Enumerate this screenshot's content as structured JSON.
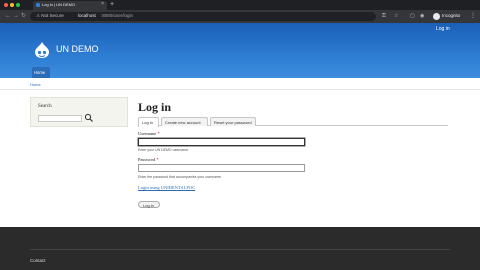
{
  "browser": {
    "tab_title": "Log in | UN DEMO",
    "tab_close": "×",
    "new_tab": "+",
    "security_label": "Not Secure",
    "url_host": "localhost",
    "url_path": ":8080/user/login",
    "profile_label": "Incognito",
    "icons": [
      "back-arrow-icon",
      "forward-arrow-icon",
      "reload-icon",
      "key-icon",
      "star-icon",
      "incognito-icon",
      "kebab-menu-icon"
    ],
    "colors": {
      "tabstrip": "#1f2023",
      "toolbar": "#35363a",
      "omnibox": "#202124"
    }
  },
  "header": {
    "login_link": "Log in",
    "site_name": "UN DEMO",
    "nav": [
      {
        "label": "Home"
      }
    ],
    "colors": {
      "accent": "#2d7dd2"
    }
  },
  "breadcrumb": {
    "home": "Home"
  },
  "sidebar": {
    "title": "Search",
    "search_value": ""
  },
  "main": {
    "title": "Log in",
    "tabs": [
      {
        "label": "Log in",
        "active": true
      },
      {
        "label": "Create new account",
        "active": false
      },
      {
        "label": "Reset your password",
        "active": false
      }
    ],
    "username": {
      "label": "Username",
      "required_mark": "*",
      "value": "",
      "description": "Enter your UN DEMO username."
    },
    "password": {
      "label": "Password",
      "required_mark": "*",
      "value": "",
      "description": "Enter the password that accompanies your username."
    },
    "sso_link": "Login using UNIDENTALPOC",
    "submit_label": "Log in"
  },
  "footer": {
    "link": "Contact"
  }
}
